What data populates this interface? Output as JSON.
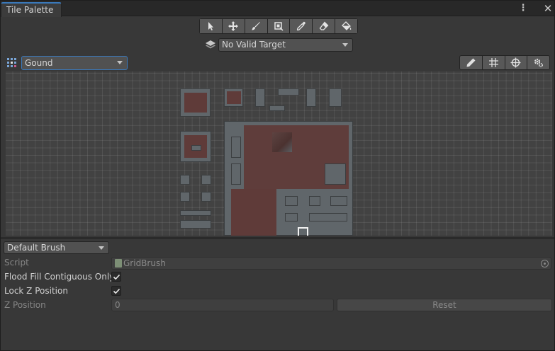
{
  "window": {
    "tab_title": "Tile Palette",
    "more_icon": "kebab-menu-icon",
    "close_icon": "close-icon"
  },
  "toolbar": {
    "tools": [
      {
        "name": "select-tool",
        "icon": "arrow-pointer-icon"
      },
      {
        "name": "move-tool",
        "icon": "move-arrows-icon"
      },
      {
        "name": "paint-tool",
        "icon": "brush-icon"
      },
      {
        "name": "box-fill-tool",
        "icon": "box-select-icon"
      },
      {
        "name": "picker-tool",
        "icon": "eyedropper-icon"
      },
      {
        "name": "erase-tool",
        "icon": "eraser-icon"
      },
      {
        "name": "fill-tool",
        "icon": "paint-bucket-icon"
      }
    ]
  },
  "active_target": {
    "value": "No Valid Target",
    "icon": "layers-icon"
  },
  "palette": {
    "selected": "Gound",
    "icon": "tile-palette-icon",
    "edit_buttons": [
      "edit-pencil-icon",
      "grid-icon",
      "gizmo-icon",
      "settings-gear-icon"
    ]
  },
  "brush": {
    "selected": "Default Brush",
    "properties": {
      "script_label": "Script",
      "script_value": "GridBrush",
      "flood_fill_label": "Flood Fill Contiguous Only",
      "flood_fill_checked": true,
      "lock_z_label": "Lock Z Position",
      "lock_z_checked": true,
      "z_position_label": "Z Position",
      "z_position_value": "0",
      "reset_label": "Reset"
    }
  },
  "colors": {
    "accent": "#3a79bb",
    "panel": "#383838",
    "grid_bg": "#424242",
    "tile_rust": "#5f3b39",
    "tile_stone": "#60666a"
  }
}
